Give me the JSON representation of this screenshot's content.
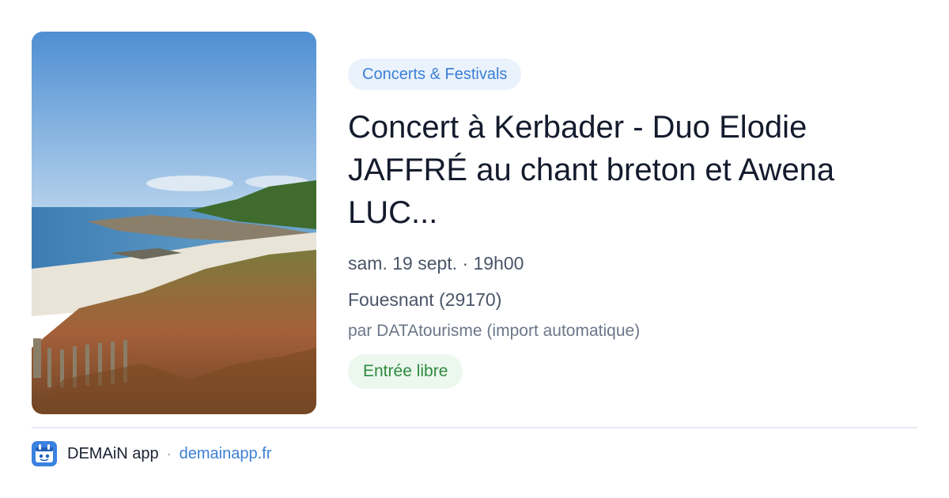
{
  "event": {
    "category": "Concerts & Festivals",
    "title_lines": [
      "Concert à Kerbader - Duo Elodie",
      "JAFFRÉ au chant breton et Awena",
      "LUC..."
    ],
    "datetime": "sam. 19 sept. · 19h00",
    "location": "Fouesnant (29170)",
    "source": "par DATAtourisme (import automatique)",
    "price": "Entrée libre"
  },
  "footer": {
    "app_name": "DEMAiN app",
    "separator": "·",
    "url": "demainapp.fr"
  },
  "colors": {
    "accent_blue": "#3b7fd4",
    "category_bg": "#eaf2fc",
    "price_green": "#2e8b3e",
    "price_bg": "#ecf7ee"
  },
  "icons": {
    "app_logo": "demain-logo-icon"
  }
}
